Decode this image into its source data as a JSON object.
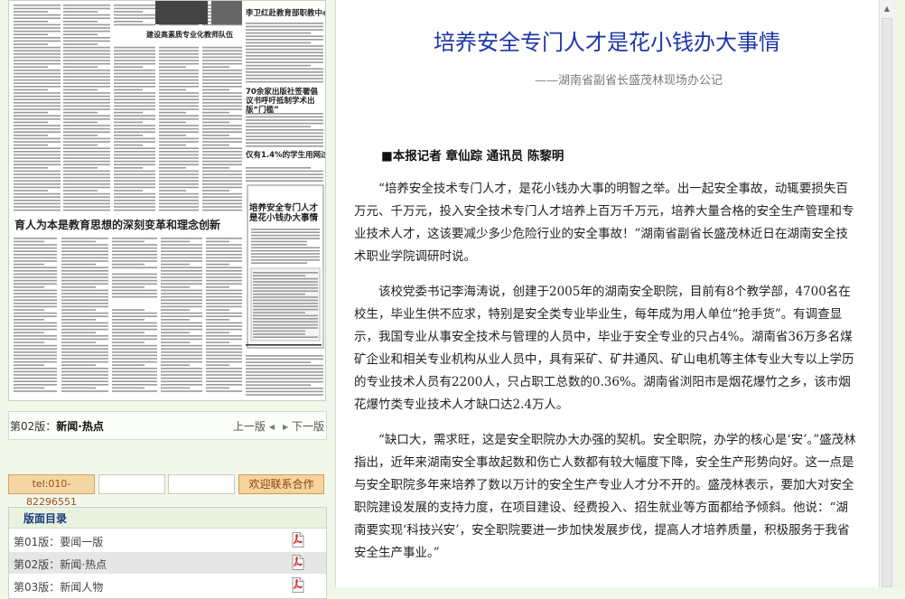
{
  "newspaper_thumbnail": {
    "headlines": [
      "李卫红赴教育部职教中心研究所调研党建工作",
      "建设高素质专业化教师队伍",
      "70余家出版社签署倡议书呼吁抵制学术出版“门槛”",
      "仅有1.4%的学生用网过度",
      "培养安全专门人才是花小钱办大事情",
      "育人为本是教育思想的深刻变革和理念创新"
    ]
  },
  "edition_bar": {
    "edition_prefix": "第02版：",
    "edition_name": "新闻·热点",
    "prev_label": "上一版",
    "next_label": "下一版"
  },
  "contact": {
    "phone": "tel:010-82296551",
    "button_label": "欢迎联系合作"
  },
  "toc": {
    "title": "版面目录",
    "items": [
      {
        "label": "第01版：要闻一版",
        "active": false
      },
      {
        "label": "第02版：新闻·热点",
        "active": true
      },
      {
        "label": "第03版：新闻人物",
        "active": false
      }
    ]
  },
  "article": {
    "title": "培养安全专门人才是花小钱办大事情",
    "subtitle": "——湖南省副省长盛茂林现场办公记",
    "byline": "■本报记者 章仙踪 通讯员 陈黎明",
    "paragraphs": [
      "“培养安全技术专门人才，是花小钱办大事的明智之举。出一起安全事故，动辄要损失百万元、千万元，投入安全技术专门人才培养上百万千万元，培养大量合格的安全生产管理和专业技术人才，这该要减少多少危险行业的安全事故！”湖南省副省长盛茂林近日在湖南安全技术职业学院调研时说。",
      "该校党委书记李海涛说，创建于2005年的湖南安全职院，目前有8个教学部，4700名在校生，毕业生供不应求，特别是安全类专业毕业生，每年成为用人单位“抢手货”。有调查显示，我国专业从事安全技术与管理的人员中，毕业于安全专业的只占4%。湖南省36万多名煤矿企业和相关专业机构从业人员中，具有采矿、矿井通风、矿山电机等主体专业大专以上学历的专业技术人员有2200人，只占职工总数的0.36%。湖南省浏阳市是烟花爆竹之乡，该市烟花爆竹类专业技术人才缺口达2.4万人。",
      "“缺口大，需求旺，这是安全职院办大办强的契机。安全职院，办学的核心是‘安’。”盛茂林指出，近年来湖南安全事故起数和伤亡人数都有较大幅度下降，安全生产形势向好。这一点是与安全职院多年来培养了数以万计的安全生产专业人才分不开的。盛茂林表示，要加大对安全职院建设发展的支持力度，在项目建设、经费投入、招生就业等方面都给予倾斜。他说：“湖南要实现‘科技兴安’，安全职院要进一步加快发展步伐，提高人才培养质量，积极服务于我省安全生产事业。”"
    ]
  },
  "colors": {
    "title_blue": "#1d36a8",
    "page_bg": "#f2f7ec",
    "button_orange": "#f5d39c"
  },
  "icons": {
    "pdf": "pdf-icon",
    "prev": "triangle-left-icon",
    "next": "triangle-right-icon",
    "scroll_up": "arrow-up-icon"
  }
}
